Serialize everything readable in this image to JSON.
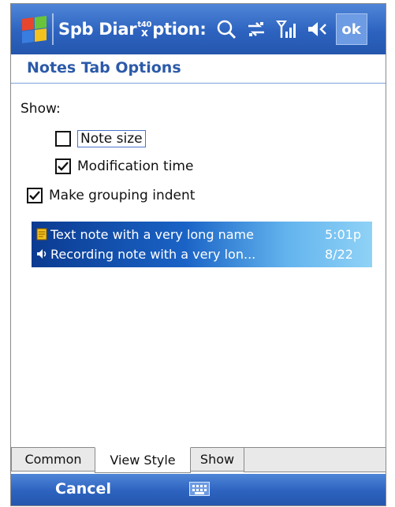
{
  "titlebar": {
    "title_left": "Spb Diar",
    "title_glyph_top": "t40",
    "title_glyph_bottom": "x",
    "title_right": "ption:",
    "ok_label": "ok"
  },
  "header": {
    "title": "Notes Tab Options"
  },
  "options": {
    "show_label": "Show:",
    "note_size": {
      "label": "Note size",
      "checked": false
    },
    "modification_time": {
      "label": "Modification time",
      "checked": true
    },
    "grouping_indent": {
      "label": "Make grouping indent",
      "checked": true
    }
  },
  "preview": {
    "rows": [
      {
        "icon": "text-note-icon",
        "text": "Text note with a very long name",
        "time": "5:01p"
      },
      {
        "icon": "recording-note-icon",
        "text": "Recording note with a very lon...",
        "time": "8/22"
      }
    ]
  },
  "tabs": [
    {
      "label": "Common",
      "active": false
    },
    {
      "label": "View Style",
      "active": true
    },
    {
      "label": "Show",
      "active": false
    }
  ],
  "bottombar": {
    "left_softkey": "Cancel",
    "input_icon": "keyboard-icon"
  },
  "colors": {
    "titlebar": "#2d63bf",
    "header_text": "#2c5aa9",
    "selection": "#0c3a8e"
  }
}
